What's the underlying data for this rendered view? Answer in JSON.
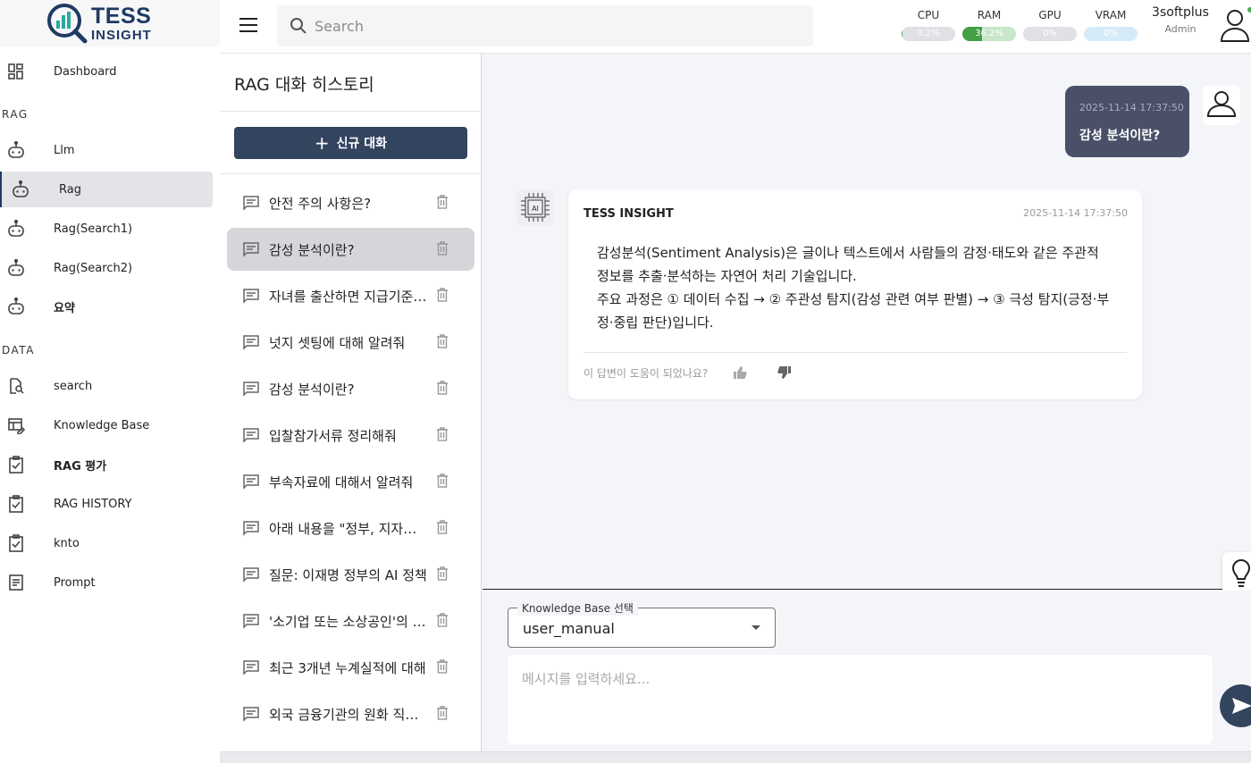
{
  "logo": {
    "line1": "TESS",
    "line2": "INSIGHT"
  },
  "sidebar": {
    "dashboard": "Dashboard",
    "section_rag": "RAG",
    "rag_items": [
      "Llm",
      "Rag",
      "Rag(Search1)",
      "Rag(Search2)",
      "요약"
    ],
    "section_data": "DATA",
    "data_items": [
      "search",
      "Knowledge Base",
      "RAG 평가",
      "RAG HISTORY",
      "knto",
      "Prompt"
    ]
  },
  "topbar": {
    "search_placeholder": "Search",
    "metrics": [
      {
        "name": "CPU",
        "value": "0.2%",
        "fill": 0.002,
        "track": "#dfe1e5",
        "color": "#4caf50"
      },
      {
        "name": "RAM",
        "value": "36.2%",
        "fill": 0.362,
        "track": "#c8e6c9",
        "color": "#43a047"
      },
      {
        "name": "GPU",
        "value": "0%",
        "fill": 0,
        "track": "#dfe1e5",
        "color": "#9e9e9e"
      },
      {
        "name": "VRAM",
        "value": "0%",
        "fill": 0,
        "track": "#d6ebfa",
        "color": "#2196f3"
      }
    ],
    "user_name": "3softplus",
    "user_role": "Admin"
  },
  "history": {
    "title": "RAG 대화 히스토리",
    "new_chat": "신규 대화",
    "items": [
      "안전 주의 사항은?",
      "감성 분석이란?",
      "자녀를 출산하면 지급기준이 어떻게 되나요?",
      "넛지 셋팅에 대해 알려줘",
      "감성 분석이란?",
      "입찰참가서류 정리해줘",
      "부속자료에 대해서 알려줘",
      "아래 내용을 \"정부, 지자체 지원사업\"",
      "질문: 이재명 정부의 AI 정책",
      "'소기업 또는 소상공인'의 정의",
      "최근 3개년 누계실적에 대해",
      "외국 금융기관의 원화 직접 거래"
    ],
    "active_index": 1
  },
  "chat": {
    "user_message": {
      "timestamp": "2025-11-14 17:37:50",
      "text": "감성 분석이란?"
    },
    "ai_message": {
      "sender": "TESS INSIGHT",
      "timestamp": "2025-11-14 17:37:50",
      "line1": "감성분석(Sentiment Analysis)은 글이나 텍스트에서 사람들의 감정·태도와 같은 주관적 정보를 추출·분석하는 자연어 처리 기술입니다.",
      "line2": "주요 과정은 ① 데이터 수집 → ② 주관성 탐지(감성 관련 여부 판별) → ③ 극성 탐지(긍정·부정·중립 판단)입니다.",
      "feedback_prompt": "이 답변이 도움이 되었나요?"
    }
  },
  "input": {
    "kb_label": "Knowledge Base 선택",
    "kb_selected": "user_manual",
    "message_placeholder": "메시지를 입력하세요..."
  }
}
